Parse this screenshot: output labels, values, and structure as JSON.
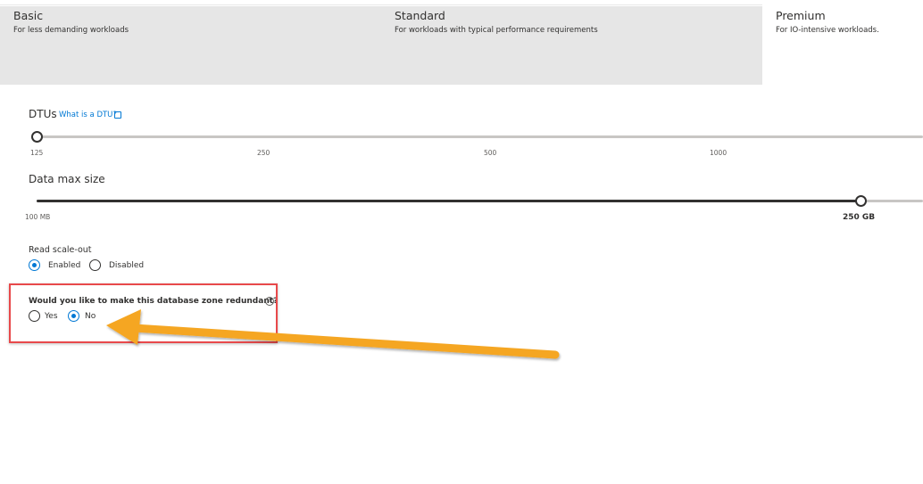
{
  "tiers": [
    {
      "name": "Basic",
      "description": "For less demanding workloads",
      "selected": false
    },
    {
      "name": "Standard",
      "description": "For workloads with typical performance requirements",
      "selected": false
    },
    {
      "name": "Premium",
      "description": "For IO-intensive workloads.",
      "selected": true
    }
  ],
  "dtus": {
    "label": "DTUs",
    "help_link": "What is a DTU?",
    "ticks": [
      "125",
      "250",
      "500",
      "1000"
    ],
    "value_fraction": 0.0
  },
  "data_max_size": {
    "label": "Data max size",
    "min_label": "100 MB",
    "value": "250 GB",
    "value_fraction": 0.93
  },
  "read_scale_out": {
    "label": "Read scale-out",
    "options": [
      {
        "label": "Enabled",
        "checked": true
      },
      {
        "label": "Disabled",
        "checked": false
      }
    ]
  },
  "zone_redundant": {
    "question": "Would you like to make this database zone redundant?",
    "info_icon": "info-icon",
    "options": [
      {
        "label": "Yes",
        "checked": false
      },
      {
        "label": "No",
        "checked": true
      }
    ]
  },
  "annotation": {
    "box_color": "#e8494b",
    "arrow_color": "#f5a623"
  },
  "colors": {
    "accent": "#0078d4",
    "tier_bg": "#e6e6e6"
  }
}
